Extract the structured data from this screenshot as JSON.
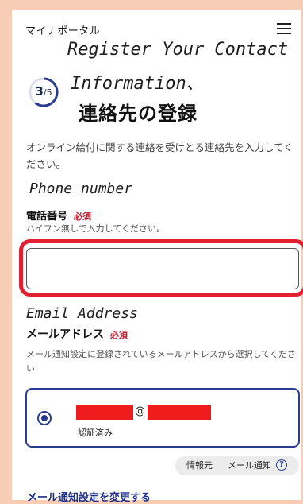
{
  "header": {
    "brand": "マイナポータル",
    "menu_icon": "hamburger-menu-icon"
  },
  "annotations": {
    "title_line1": "Register Your Contact",
    "title_line2": "Information、",
    "phone": "Phone number",
    "email": "Email Address"
  },
  "step": {
    "current": "3",
    "total": "/5"
  },
  "page_title": "連絡先の登録",
  "intro": "オンライン給付に関する連絡を受けとる連絡先を入力してください。",
  "phone": {
    "label": "電話番号",
    "required": "必須",
    "hint": "ハイフン無しで入力してください。",
    "value": "",
    "placeholder": ""
  },
  "email": {
    "label": "メールアドレス",
    "required": "必須",
    "hint": "メール通知設定に登録されているメールアドレスから選択してください",
    "option": {
      "at": "@",
      "status": "認証済み",
      "selected": true
    }
  },
  "source": {
    "label": "情報元",
    "value": "メール通知",
    "help_icon": "?"
  },
  "change_link": "メール通知設定を変更する",
  "colors": {
    "accent": "#2b3c8e",
    "required": "#c0182d",
    "highlight": "#e3202f",
    "background": "#f7cdb6"
  }
}
